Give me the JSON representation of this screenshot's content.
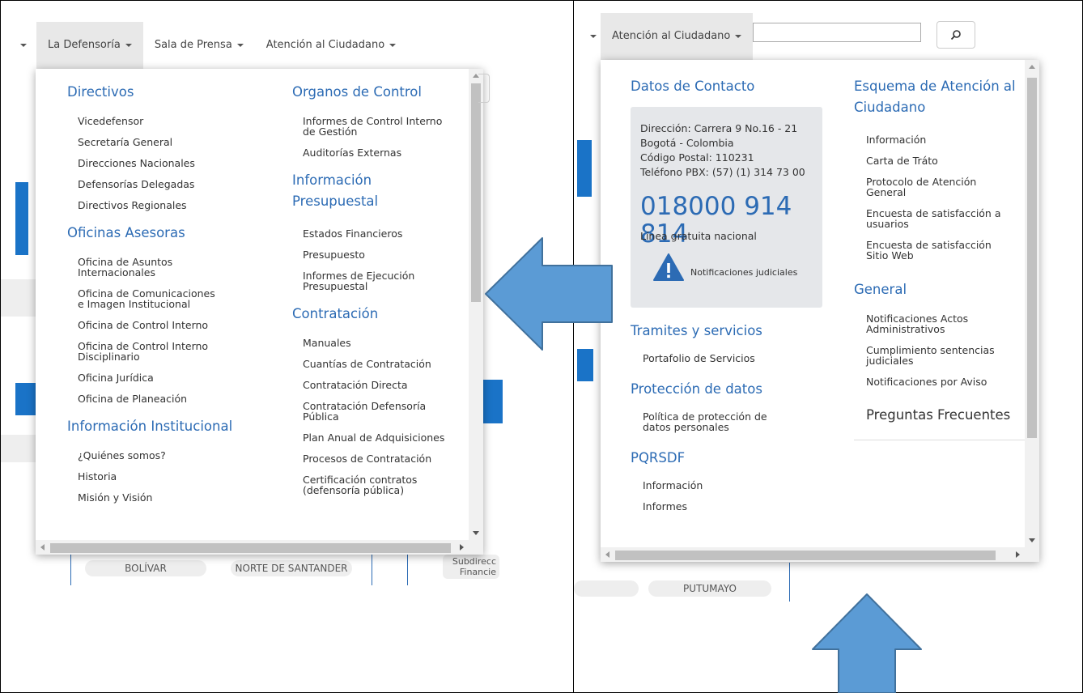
{
  "left": {
    "nav": {
      "la_defensoria": "La Defensoría",
      "sala_prensa": "Sala de Prensa",
      "atencion": "Atención al Ciudadano"
    },
    "col1": [
      {
        "heading": "Directivos",
        "links": [
          "Vicedefensor",
          "Secretaría General",
          "Direcciones Nacionales",
          "Defensorías Delegadas",
          "Directivos Regionales"
        ]
      },
      {
        "heading": "Oficinas Asesoras",
        "links": [
          "Oficina de Asuntos\nInternacionales",
          "Oficina de Comunicaciones\ne Imagen Institucional",
          "Oficina de Control Interno",
          "Oficina de Control Interno\nDisciplinario",
          "Oficina Jurídica",
          "Oficina de Planeación"
        ]
      },
      {
        "heading": "Información Institucional",
        "links": [
          "¿Quiénes somos?",
          "Historia",
          "Misión y Visión"
        ]
      }
    ],
    "col2": [
      {
        "heading": "Organos de Control",
        "links": [
          "Informes de Control Interno\nde Gestión",
          "Auditorías Externas"
        ]
      },
      {
        "heading": "Información\nPresupuestal",
        "links": [
          "Estados Financieros",
          "Presupuesto",
          "Informes de Ejecución\nPresupuestal"
        ]
      },
      {
        "heading": "Contratación",
        "links": [
          "Manuales",
          "Cuantías de Contratación",
          "Contratación Directa",
          "Contratación Defensoría\nPública",
          "Plan Anual de Adquisiciones",
          "Procesos de Contratación",
          "Certificación contratos\n(defensoría pública)"
        ]
      }
    ],
    "background": {
      "pill_1": "BOLÍVAR",
      "pill_2": "NORTE DE SANTANDER",
      "frag_subdirec": "Subdirecc\nFinancie"
    }
  },
  "right": {
    "nav": {
      "atencion": "Atención al Ciudadano"
    },
    "search_icon": "search-icon",
    "contact": {
      "heading": "Datos de Contacto",
      "direccion": "Dirección: Carrera 9 No.16 - 21",
      "ciudad": "Bogotá - Colombia",
      "postal": "Código Postal: 110231",
      "telefono": "Teléfono PBX: (57) (1) 314 73 00",
      "linea": "018000 914 814",
      "linea_label": "Línea gratuita nacional",
      "notificaciones": "Notificaciones judiciales"
    },
    "tramites": {
      "heading": "Tramites y servicios",
      "links": [
        "Portafolio de Servicios"
      ]
    },
    "proteccion": {
      "heading": "Protección de datos",
      "links": [
        "Política de protección de\ndatos personales"
      ]
    },
    "pqrsdf": {
      "heading": "PQRSDF",
      "links": [
        "Información",
        "Informes"
      ]
    },
    "esquema": {
      "heading": "Esquema de Atención al\nCiudadano",
      "links": [
        "Información",
        "Carta de Tráto",
        "Protocolo de Atención\nGeneral",
        "Encuesta de satisfacción a\nusuarios",
        "Encuesta de satisfacción\nSitio Web"
      ]
    },
    "general": {
      "heading": "General",
      "links": [
        "Notificaciones Actos\nAdministrativos",
        "Cumplimiento sentencias\njudiciales",
        "Notificaciones por Aviso"
      ]
    },
    "preguntas": "Preguntas Frecuentes",
    "background": {
      "pill_1": "PUTUMAYO"
    }
  },
  "colors": {
    "link_blue": "#2c6bb4",
    "arrow_blue": "#5b9bd5",
    "arrow_border": "#41719c"
  }
}
